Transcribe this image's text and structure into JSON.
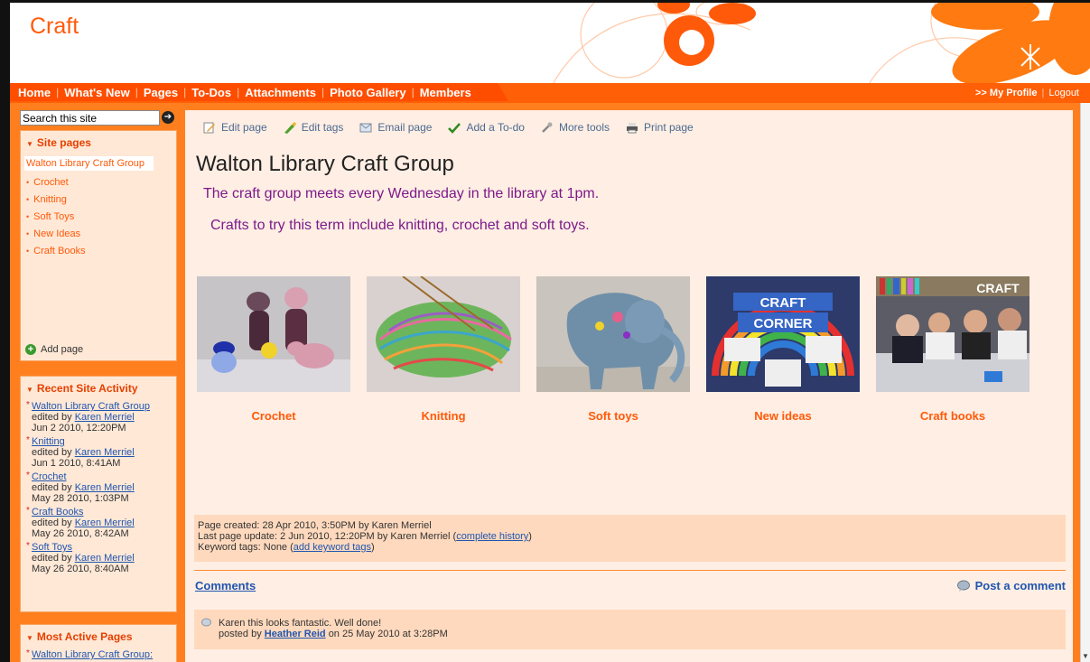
{
  "site": {
    "title": "Craft"
  },
  "nav": {
    "items": [
      "Home",
      "What's New",
      "Pages",
      "To-Dos",
      "Attachments",
      "Photo Gallery",
      "Members"
    ],
    "profile": ">> My Profile",
    "logout": "Logout"
  },
  "sidebar": {
    "search_value": "Search this site",
    "site_pages": {
      "heading": "Site pages",
      "current": "Walton Library Craft Group",
      "items": [
        "Crochet",
        "Knitting",
        "Soft Toys",
        "New Ideas",
        "Craft Books"
      ],
      "add_page": "Add page"
    },
    "recent_activity": {
      "heading": "Recent Site Activity",
      "items": [
        {
          "page": "Walton Library Craft Group",
          "edited_by": "edited by",
          "user": "Karen Merriel",
          "date": "Jun 2 2010, 12:20PM"
        },
        {
          "page": "Knitting",
          "edited_by": "edited by",
          "user": "Karen Merriel",
          "date": "Jun 1 2010, 8:41AM"
        },
        {
          "page": "Crochet",
          "edited_by": "edited by",
          "user": "Karen Merriel",
          "date": "May 28 2010, 1:03PM"
        },
        {
          "page": "Craft Books",
          "edited_by": "edited by",
          "user": "Karen Merriel",
          "date": "May 26 2010, 8:42AM"
        },
        {
          "page": "Soft Toys",
          "edited_by": "edited by",
          "user": "Karen Merriel",
          "date": "May 26 2010, 8:40AM"
        }
      ]
    },
    "most_active": {
      "heading": "Most Active Pages",
      "items": [
        "Walton Library Craft Group:"
      ]
    }
  },
  "toolbar": {
    "edit_page": "Edit page",
    "edit_tags": "Edit tags",
    "email_page": "Email page",
    "add_todo": "Add a To-do",
    "more_tools": "More tools",
    "print_page": "Print page"
  },
  "page": {
    "title": "Walton Library Craft Group",
    "para1": "The craft group meets every Wednesday in the library at 1pm.",
    "para2": "Crafts to try this term include knitting, crochet and soft toys.",
    "gallery": [
      "Crochet",
      "Knitting",
      "Soft toys",
      "New ideas",
      "Craft books"
    ],
    "gallery_sign_text": [
      "CRAFT",
      "CORNER",
      "CRAFT"
    ]
  },
  "info": {
    "created": "Page created: 28 Apr 2010, 3:50PM by Karen Merriel",
    "updated": "Last page update: 2 Jun 2010, 12:20PM by Karen Merriel (",
    "history": "complete history",
    "updated_end": ")",
    "keywords": "Keyword tags: None (",
    "add_keywords": "add keyword tags",
    "keywords_end": ")"
  },
  "comments": {
    "heading": "Comments",
    "post": "Post a comment",
    "items": [
      {
        "text": "Karen this looks fantastic. Well done!",
        "posted_by": "posted by",
        "user": "Heather Reid",
        "date": "on 25 May 2010 at 3:28PM"
      }
    ]
  },
  "colors": {
    "accent": "#ff5a0a",
    "nav": "#ff4d00",
    "frame": "#ff7f1e",
    "link": "#1f55b0"
  }
}
